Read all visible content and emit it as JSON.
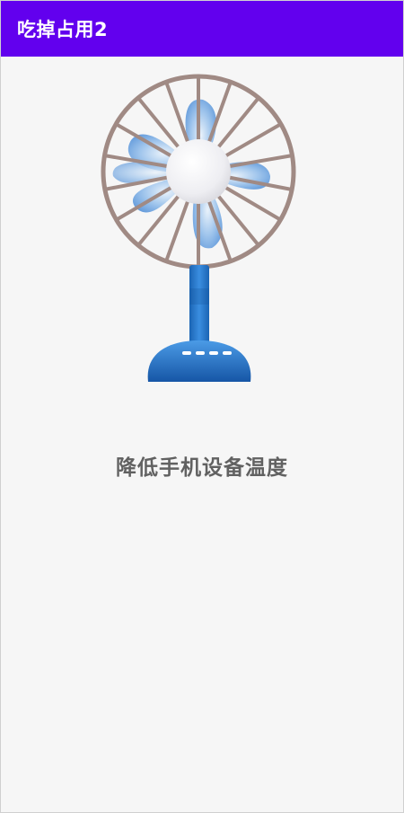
{
  "app_bar": {
    "title": "吃掉占用2",
    "color": "#6200ee"
  },
  "illustration": {
    "icon": "desk-fan-illustration",
    "blade_color": "#7fb0e6",
    "guard_color": "#a08a84",
    "base_color": "#1f6fc0"
  },
  "main": {
    "caption": "降低手机设备温度"
  }
}
